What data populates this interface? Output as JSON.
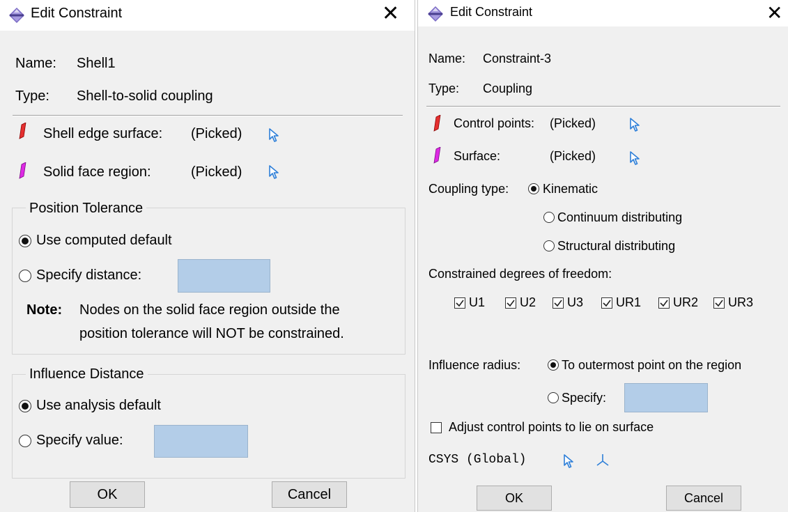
{
  "dialog_a": {
    "title": "Edit Constraint",
    "close_glyph": "✕",
    "name_label": "Name:",
    "name_value": "Shell1",
    "type_label": "Type:",
    "type_value": "Shell-to-solid coupling",
    "shell_edge_label": "Shell edge surface:",
    "shell_edge_value": "(Picked)",
    "solid_face_label": "Solid face region:",
    "solid_face_value": "(Picked)",
    "position_tolerance": {
      "title": "Position Tolerance",
      "option_default": "Use computed default",
      "option_specify": "Specify distance:",
      "selected": "default",
      "distance_value": "",
      "note_label": "Note:",
      "note_line1": "Nodes on the solid face region outside the",
      "note_line2": "position tolerance will NOT be constrained."
    },
    "influence_distance": {
      "title": "Influence Distance",
      "option_default": "Use analysis default",
      "option_specify": "Specify value:",
      "selected": "default",
      "value": ""
    },
    "ok_label": "OK",
    "cancel_label": "Cancel"
  },
  "dialog_b": {
    "title": "Edit Constraint",
    "close_glyph": "✕",
    "name_label": "Name:",
    "name_value": "Constraint-3",
    "type_label": "Type:",
    "type_value": "Coupling",
    "control_points_label": "Control points:",
    "control_points_value": "(Picked)",
    "surface_label": "Surface:",
    "surface_value": "(Picked)",
    "coupling_type_label": "Coupling type:",
    "coupling_options": [
      "Kinematic",
      "Continuum distributing",
      "Structural distributing"
    ],
    "coupling_selected": "Kinematic",
    "dof_label": "Constrained degrees of freedom:",
    "dof": [
      {
        "label": "U1",
        "checked": true
      },
      {
        "label": "U2",
        "checked": true
      },
      {
        "label": "U3",
        "checked": true
      },
      {
        "label": "UR1",
        "checked": true
      },
      {
        "label": "UR2",
        "checked": true
      },
      {
        "label": "UR3",
        "checked": true
      }
    ],
    "influence_radius_label": "Influence radius:",
    "influence_outermost": "To outermost point on the region",
    "influence_specify": "Specify:",
    "influence_selected": "outermost",
    "influence_value": "",
    "adjust_label": "Adjust control points to lie on surface",
    "adjust_checked": false,
    "csys_label": "CSYS (Global)",
    "ok_label": "OK",
    "cancel_label": "Cancel"
  },
  "colors": {
    "dialog_bg": "#f0f0f0",
    "field_bg": "#b3cde8",
    "pick_arrow": "#2e7fd8",
    "shell_region_icon": "#e02020",
    "solid_region_icon": "#d81adf",
    "app_icon": "#6a5fb0"
  },
  "icons": {
    "app": "abaqus-app-icon",
    "pick": "select-arrow-icon",
    "region_red": "red-region-icon",
    "region_magenta": "magenta-region-icon",
    "csys": "csys-triad-icon"
  }
}
